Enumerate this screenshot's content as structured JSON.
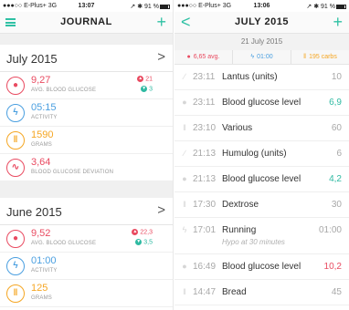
{
  "colors": {
    "accent": "#2fc1a4",
    "glucose": "#e94b61",
    "activity": "#4a9fe0",
    "grams": "#f5a623",
    "deviation": "#e94b61",
    "low": "#2fbaa2"
  },
  "left": {
    "status": {
      "carrier": "●●●○○ E-Plus+ 3G",
      "time": "13:07",
      "battery": "↗ ✱ 91 %"
    },
    "nav": {
      "title": "JOURNAL",
      "add": "+"
    },
    "months": [
      {
        "name": "July 2015",
        "chevron": ">",
        "stats": {
          "glucose": {
            "value": "9,27",
            "label": "AVG. BLOOD GLUCOSE",
            "max": "21",
            "min": "3",
            "icon": "drop-icon"
          },
          "activity": {
            "value": "05:15",
            "label": "ACTIVITY",
            "icon": "bolt-icon"
          },
          "grams": {
            "value": "1590",
            "label": "GRAMS",
            "icon": "cutlery-icon"
          },
          "deviation": {
            "value": "3,64",
            "label": "BLOOD GLUCOSE DEVIATION",
            "icon": "trend-icon"
          }
        }
      },
      {
        "name": "June 2015",
        "chevron": ">",
        "stats": {
          "glucose": {
            "value": "9,52",
            "label": "AVG. BLOOD GLUCOSE",
            "max": "22,3",
            "min": "3,5",
            "icon": "drop-icon"
          },
          "activity": {
            "value": "01:00",
            "label": "ACTIVITY",
            "icon": "bolt-icon"
          },
          "grams": {
            "value": "125",
            "label": "GRAMS",
            "icon": "cutlery-icon"
          }
        }
      }
    ]
  },
  "right": {
    "status": {
      "carrier": "●●●○○ E-Plus+ 3G",
      "time": "13:06",
      "battery": "↗ ✱ 91 %"
    },
    "nav": {
      "title": "JULY 2015",
      "back": "<",
      "add": "+"
    },
    "date": "21 July 2015",
    "summary": {
      "glucose": "6,65 avg.",
      "activity": "01:00",
      "carbs": "195 carbs"
    },
    "entries": [
      {
        "time": "23:11",
        "name": "Lantus (units)",
        "value": "10",
        "icon": "syringe-icon"
      },
      {
        "time": "23:11",
        "name": "Blood glucose level",
        "value": "6,9",
        "icon": "drop-icon"
      },
      {
        "time": "23:10",
        "name": "Various",
        "value": "60",
        "icon": "cutlery-icon"
      },
      {
        "time": "21:13",
        "name": "Humulog (units)",
        "value": "6",
        "icon": "syringe-icon"
      },
      {
        "time": "21:13",
        "name": "Blood glucose level",
        "value": "4,2",
        "icon": "drop-icon"
      },
      {
        "time": "17:30",
        "name": "Dextrose",
        "value": "30",
        "icon": "cutlery-icon"
      },
      {
        "time": "17:01",
        "name": "Running",
        "value": "01:00",
        "note": "Hypo at 30 minutes",
        "icon": "bolt-icon"
      },
      {
        "time": "16:49",
        "name": "Blood glucose level",
        "value": "10,2",
        "icon": "drop-icon"
      },
      {
        "time": "14:47",
        "name": "Bread",
        "value": "45",
        "icon": "cutlery-icon"
      }
    ]
  }
}
